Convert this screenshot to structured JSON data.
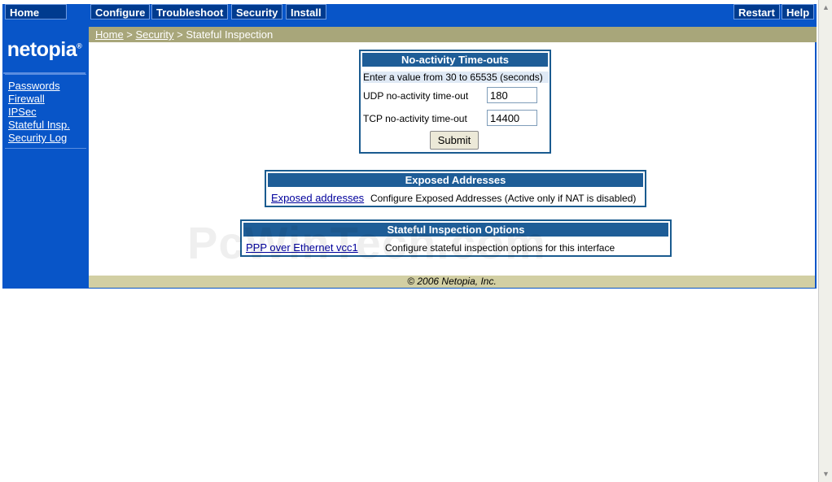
{
  "topnav": {
    "home": "Home",
    "configure": "Configure",
    "troubleshoot": "Troubleshoot",
    "security": "Security",
    "install": "Install",
    "restart": "Restart",
    "help": "Help"
  },
  "logo": {
    "text": "netopia",
    "mark": "®"
  },
  "sidebar": {
    "items": [
      {
        "label": "Passwords"
      },
      {
        "label": "Firewall"
      },
      {
        "label": "IPSec"
      },
      {
        "label": "Stateful Insp."
      },
      {
        "label": "Security Log"
      }
    ]
  },
  "breadcrumb": {
    "home": "Home",
    "sep1": " > ",
    "security": "Security",
    "sep2": " > ",
    "current": "Stateful Inspection"
  },
  "timeouts": {
    "title": "No-activity Time-outs",
    "hint": "Enter a value from 30 to 65535 (seconds)",
    "udp_label": "UDP no-activity time-out",
    "udp_value": "180",
    "tcp_label": "TCP no-activity time-out",
    "tcp_value": "14400",
    "submit": "Submit"
  },
  "exposed": {
    "title": "Exposed Addresses",
    "link": "Exposed addresses",
    "desc": "Configure Exposed Addresses (Active only if NAT is disabled)"
  },
  "stateful": {
    "title": "Stateful Inspection Options",
    "link": "PPP over Ethernet vcc1",
    "desc": "Configure stateful inspection options for this interface"
  },
  "footer": {
    "text": "© 2006 Netopia, Inc."
  },
  "watermark": "PcWinTech.com",
  "colors": {
    "nav_blue": "#0855c8",
    "button_blue": "#003b8f",
    "header_blue": "#1e5d97",
    "breadcrumb_olive": "#a8a67a",
    "footer_tan": "#d2cfa3"
  }
}
